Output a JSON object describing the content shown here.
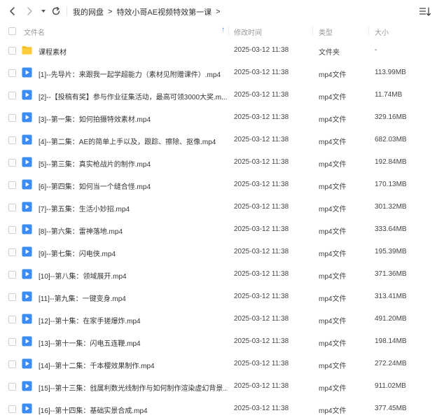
{
  "breadcrumb": {
    "items": [
      "我的网盘",
      "特效小哥AE视频特效第一课"
    ],
    "separator": ">"
  },
  "header": {
    "name": "文件名",
    "time": "修改时间",
    "type": "类型",
    "size": "大小"
  },
  "colors": {
    "accent": "#3b8cf5",
    "folder": "#f7c02b",
    "video": "#3b8cf5"
  },
  "files": [
    {
      "name": "课程素材",
      "time": "2025-03-12 11:38",
      "type": "文件夹",
      "size": "-",
      "kind": "folder"
    },
    {
      "name": "[1]--先导片：来跟我一起学超能力（素材见附赠课件）.mp4",
      "time": "2025-03-12 11:38",
      "type": "mp4文件",
      "size": "113.99MB",
      "kind": "video"
    },
    {
      "name": "[2]--【投稿有奖】参与作业征集活动，最高可领3000大奖.m...",
      "time": "2025-03-12 11:38",
      "type": "mp4文件",
      "size": "11.74MB",
      "kind": "video"
    },
    {
      "name": "[3]--第一集：如何拍摄特效素材.mp4",
      "time": "2025-03-12 11:38",
      "type": "mp4文件",
      "size": "329.16MB",
      "kind": "video"
    },
    {
      "name": "[4]--第二集：AE的简单上手以及，跟踪、擦除、抠像.mp4",
      "time": "2025-03-12 11:38",
      "type": "mp4文件",
      "size": "682.03MB",
      "kind": "video"
    },
    {
      "name": "[5]--第三集：真实枪战片的制作.mp4",
      "time": "2025-03-12 11:38",
      "type": "mp4文件",
      "size": "192.84MB",
      "kind": "video"
    },
    {
      "name": "[6]--第四集：如何当一个缝合怪.mp4",
      "time": "2025-03-12 11:38",
      "type": "mp4文件",
      "size": "170.13MB",
      "kind": "video"
    },
    {
      "name": "[7]--第五集：生活小妙招.mp4",
      "time": "2025-03-12 11:38",
      "type": "mp4文件",
      "size": "301.32MB",
      "kind": "video"
    },
    {
      "name": "[8]--第六集：雷神落地.mp4",
      "time": "2025-03-12 11:38",
      "type": "mp4文件",
      "size": "333.64MB",
      "kind": "video"
    },
    {
      "name": "[9]--第七集：闪电侠.mp4",
      "time": "2025-03-12 11:38",
      "type": "mp4文件",
      "size": "195.39MB",
      "kind": "video"
    },
    {
      "name": "[10]--第八集：领域展开.mp4",
      "time": "2025-03-12 11:38",
      "type": "mp4文件",
      "size": "371.36MB",
      "kind": "video"
    },
    {
      "name": "[11]--第九集：一键变身.mp4",
      "time": "2025-03-12 11:38",
      "type": "mp4文件",
      "size": "313.41MB",
      "kind": "video"
    },
    {
      "name": "[12]--第十集：在家手搓爆炸.mp4",
      "time": "2025-03-12 11:38",
      "type": "mp4文件",
      "size": "491.20MB",
      "kind": "video"
    },
    {
      "name": "[13]--第十一集：闪电五连鞭.mp4",
      "time": "2025-03-12 11:38",
      "type": "mp4文件",
      "size": "198.14MB",
      "kind": "video"
    },
    {
      "name": "[14]--第十二集：千本樱效果制作.mp4",
      "time": "2025-03-12 11:38",
      "type": "mp4文件",
      "size": "272.24MB",
      "kind": "video"
    },
    {
      "name": "[15]--第十三集：戗属利数光线制作与如何制作渲染虚幻背景...",
      "time": "2025-03-12 11:38",
      "type": "mp4文件",
      "size": "911.02MB",
      "kind": "video"
    },
    {
      "name": "[16]--第十四集：基础实景合成.mp4",
      "time": "2025-03-12 11:38",
      "type": "mp4文件",
      "size": "377.45MB",
      "kind": "video"
    }
  ]
}
